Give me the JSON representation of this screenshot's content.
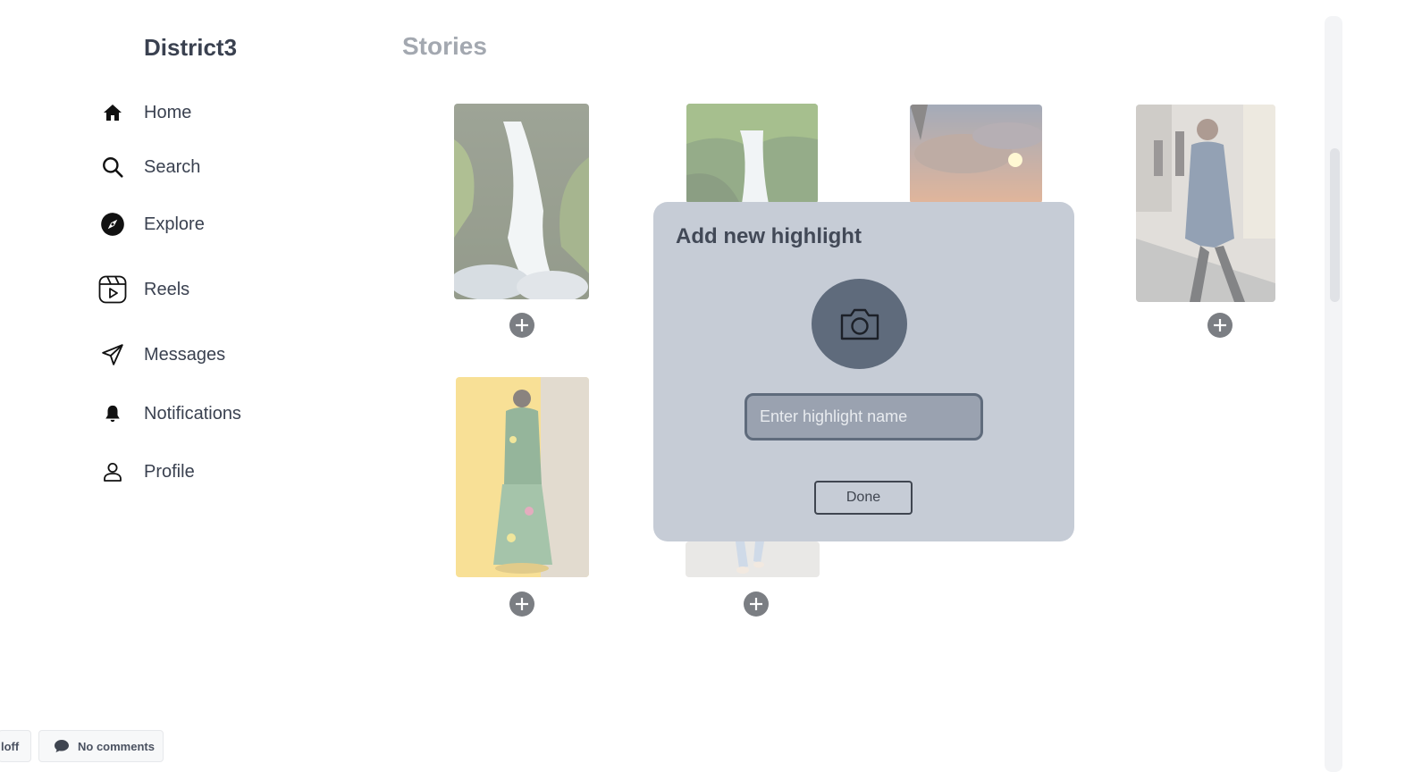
{
  "sidebar": {
    "brand": "District3",
    "items": [
      {
        "label": "Home",
        "icon": "home-icon"
      },
      {
        "label": "Search",
        "icon": "search-icon"
      },
      {
        "label": "Explore",
        "icon": "compass-icon"
      },
      {
        "label": "Reels",
        "icon": "reels-icon"
      },
      {
        "label": "Messages",
        "icon": "paper-plane-icon"
      },
      {
        "label": "Notifications",
        "icon": "bell-icon"
      },
      {
        "label": "Profile",
        "icon": "user-icon"
      }
    ]
  },
  "main": {
    "title": "Stories",
    "stories": [
      {
        "image": "waterfall"
      },
      {
        "image": "forest-waterfall"
      },
      {
        "image": "sunset-sky"
      },
      {
        "image": "man-in-coat"
      },
      {
        "image": "fashion-runway"
      },
      {
        "image": "walking-legs"
      }
    ]
  },
  "modal": {
    "title": "Add new highlight",
    "camera_icon": "camera-icon",
    "input_placeholder": "Enter highlight name",
    "done_label": "Done"
  },
  "footer": {
    "left_chip": "loff",
    "comments_label": "No comments"
  },
  "colors": {
    "modal_bg": "#c6ccd6",
    "camera_bg": "#5f6b7c",
    "input_bg": "#9aa2b0",
    "add_button": "#7b7e83",
    "title_muted": "#a3a8b0"
  }
}
